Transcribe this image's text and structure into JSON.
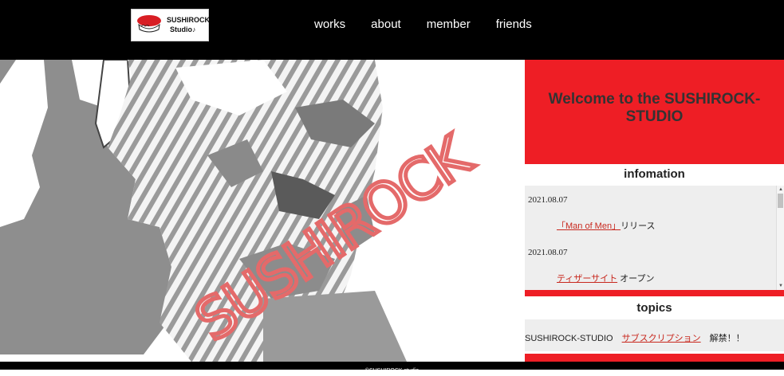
{
  "header": {
    "logo": {
      "line1": "SUSHIROCK",
      "line2": "Studio♪"
    },
    "nav": [
      "works",
      "about",
      "member",
      "friends"
    ]
  },
  "hero": {
    "graffiti_text": "SUSHIROCK"
  },
  "sidebar": {
    "welcome": "Welcome to the SUSHIROCK-STUDIO",
    "info_title": "infomation",
    "info_items": [
      {
        "date": "2021.08.07",
        "link": "「Man of Men」",
        "suffix": "リリース"
      },
      {
        "date": "2021.08.07",
        "link": "ティザーサイト",
        "suffix": " オープン"
      }
    ],
    "topics_title": "topics",
    "topics_prefix": "SUSHIROCK-STUDIO　",
    "topics_link": "サブスクリプション",
    "topics_suffix": "　解禁！！"
  },
  "footer": {
    "copyright": "©SUSHIROCK studio"
  },
  "colors": {
    "accent": "#ee1e25",
    "link": "#c8281e",
    "graffiti": "#e46a6a"
  }
}
